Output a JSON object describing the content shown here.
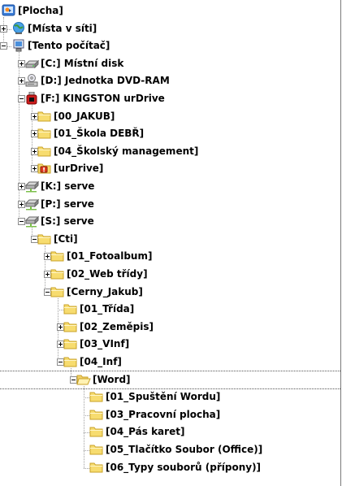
{
  "tree": {
    "items": [
      {
        "label": "[Plocha]",
        "icon": "desktop-icon",
        "level": 0,
        "state": "none"
      },
      {
        "label": "[Místa v síti]",
        "icon": "network-globe-icon",
        "level": 1,
        "state": "collapsed"
      },
      {
        "label": "[Tento počítač]",
        "icon": "computer-icon",
        "level": 1,
        "state": "expanded"
      },
      {
        "label": "[C:]  Místní disk",
        "icon": "hard-drive-icon",
        "level": 2,
        "state": "collapsed"
      },
      {
        "label": "[D:]  Jednotka DVD-RAM",
        "icon": "dvd-drive-icon",
        "level": 2,
        "state": "collapsed"
      },
      {
        "label": "[F:]  KINGSTON urDrive",
        "icon": "usb-drive-icon",
        "level": 2,
        "state": "expanded"
      },
      {
        "label": "[00_JAKUB]",
        "icon": "folder-icon",
        "level": 3,
        "state": "collapsed"
      },
      {
        "label": "[01_Škola DEBŘ]",
        "icon": "folder-icon",
        "level": 3,
        "state": "collapsed"
      },
      {
        "label": "[04_Školský management]",
        "icon": "folder-icon",
        "level": 3,
        "state": "collapsed"
      },
      {
        "label": "[urDrive]",
        "icon": "urdrive-folder-icon",
        "level": 3,
        "state": "collapsed"
      },
      {
        "label": "[K:]  serve",
        "icon": "network-drive-icon",
        "level": 2,
        "state": "collapsed"
      },
      {
        "label": "[P:]  serve",
        "icon": "network-drive-icon",
        "level": 2,
        "state": "collapsed"
      },
      {
        "label": "[S:]  serve",
        "icon": "network-drive-icon",
        "level": 2,
        "state": "expanded"
      },
      {
        "label": "[Cti]",
        "icon": "folder-icon",
        "level": 3,
        "state": "expanded"
      },
      {
        "label": "[01_Fotoalbum]",
        "icon": "folder-icon",
        "level": 4,
        "state": "collapsed"
      },
      {
        "label": "[02_Web třídy]",
        "icon": "folder-icon",
        "level": 4,
        "state": "collapsed"
      },
      {
        "label": "[Cerny_Jakub]",
        "icon": "folder-icon",
        "level": 4,
        "state": "expanded"
      },
      {
        "label": "[01_Třída]",
        "icon": "folder-icon",
        "level": 5,
        "state": "none"
      },
      {
        "label": "[02_Zeměpis]",
        "icon": "folder-icon",
        "level": 5,
        "state": "collapsed"
      },
      {
        "label": "[03_VInf]",
        "icon": "folder-icon",
        "level": 5,
        "state": "collapsed"
      },
      {
        "label": "[04_Inf]",
        "icon": "folder-icon",
        "level": 5,
        "state": "expanded"
      },
      {
        "label": "[Word]",
        "icon": "open-folder-icon",
        "level": 6,
        "state": "expanded",
        "selected": true
      },
      {
        "label": "[01_Spuštění Wordu]",
        "icon": "folder-icon",
        "level": 7,
        "state": "none"
      },
      {
        "label": "[03_Pracovní plocha]",
        "icon": "folder-icon",
        "level": 7,
        "state": "none"
      },
      {
        "label": "[04_Pás karet]",
        "icon": "folder-icon",
        "level": 7,
        "state": "none"
      },
      {
        "label": "[05_Tlačítko Soubor (Office)]",
        "icon": "folder-icon",
        "level": 7,
        "state": "none"
      },
      {
        "label": "[06_Typy souborů (přípony)]",
        "icon": "folder-icon",
        "level": 7,
        "state": "none"
      }
    ]
  },
  "colors": {
    "folder": "#f7dc6f",
    "folder_border": "#c9a227",
    "tree_lines": "#a0a0a0",
    "border": "#7a7a7a"
  }
}
